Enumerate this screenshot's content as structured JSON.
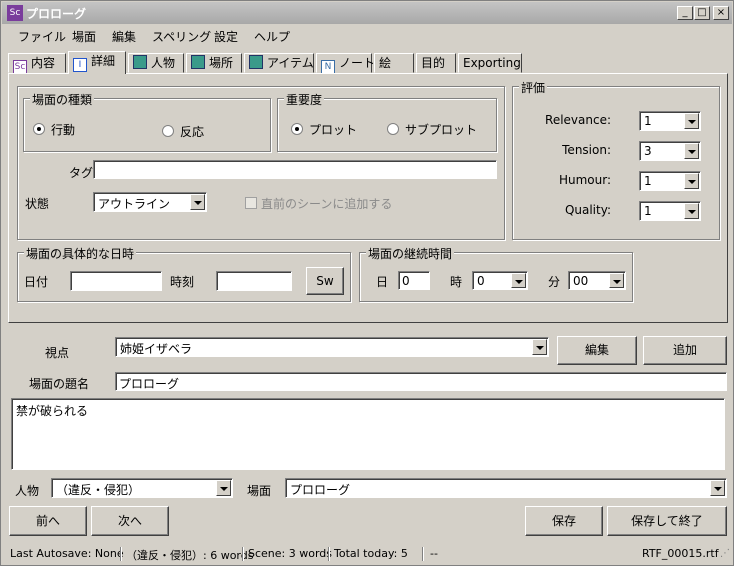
{
  "window": {
    "title": "プロローグ",
    "app_icon": "Sc",
    "controls": {
      "minimize": "_",
      "maximize": "□",
      "close": "×"
    }
  },
  "menu": [
    "ファイル",
    "場面",
    "編集",
    "スペリング",
    "設定",
    "ヘルプ"
  ],
  "tabs": [
    {
      "label": "内容",
      "icon": "Sc"
    },
    {
      "label": "詳細",
      "icon": "I",
      "active": true
    },
    {
      "label": "人物",
      "icon": "person"
    },
    {
      "label": "場所",
      "icon": "building"
    },
    {
      "label": "アイテム",
      "icon": "pen"
    },
    {
      "label": "ノート",
      "icon": "N"
    },
    {
      "label": "絵",
      "icon": ""
    },
    {
      "label": "目的",
      "icon": ""
    },
    {
      "label": "Exporting",
      "icon": ""
    }
  ],
  "scene_type": {
    "legend": "場面の種類",
    "options": [
      "行動",
      "反応"
    ],
    "selected": "行動"
  },
  "importance": {
    "legend": "重要度",
    "options": [
      "プロット",
      "サブプロット"
    ],
    "selected": "プロット"
  },
  "tags": {
    "label": "タグ",
    "value": ""
  },
  "status": {
    "label": "状態",
    "value": "アウトライン",
    "continue_label": "直前のシーンに追加する"
  },
  "rating": {
    "legend": "評価",
    "items": [
      {
        "label": "Relevance:",
        "value": "1"
      },
      {
        "label": "Tension:",
        "value": "3"
      },
      {
        "label": "Humour:",
        "value": "1"
      },
      {
        "label": "Quality:",
        "value": "1"
      }
    ]
  },
  "datetime": {
    "legend": "場面の具体的な日時",
    "date_label": "日付",
    "date_value": "",
    "time_label": "時刻",
    "time_value": "",
    "sw_button": "Sw"
  },
  "duration": {
    "legend": "場面の継続時間",
    "day_label": "日",
    "day_value": "0",
    "hour_label": "時",
    "hour_value": "0",
    "minute_label": "分",
    "minute_value": "00"
  },
  "viewpoint": {
    "label": "視点",
    "value": "姉姫イザベラ",
    "edit_button": "編集",
    "add_button": "追加"
  },
  "scene_title": {
    "label": "場面の題名",
    "value": "プロローグ"
  },
  "summary": {
    "text": "禁が破られる"
  },
  "nav": {
    "character_label": "人物",
    "character_value": "（違反・侵犯）",
    "scene_label": "場面",
    "scene_value": "プロローグ"
  },
  "buttons": {
    "prev": "前へ",
    "next": "次へ",
    "save": "保存",
    "save_close": "保存して終了"
  },
  "statusbar": {
    "autosave": "Last Autosave: None",
    "char_words": "（違反・侵犯）: 6 words",
    "scene_words": "Scene: 3 words",
    "total": "Total today: 5",
    "extra": "--",
    "file": "RTF_00015.rtf"
  }
}
